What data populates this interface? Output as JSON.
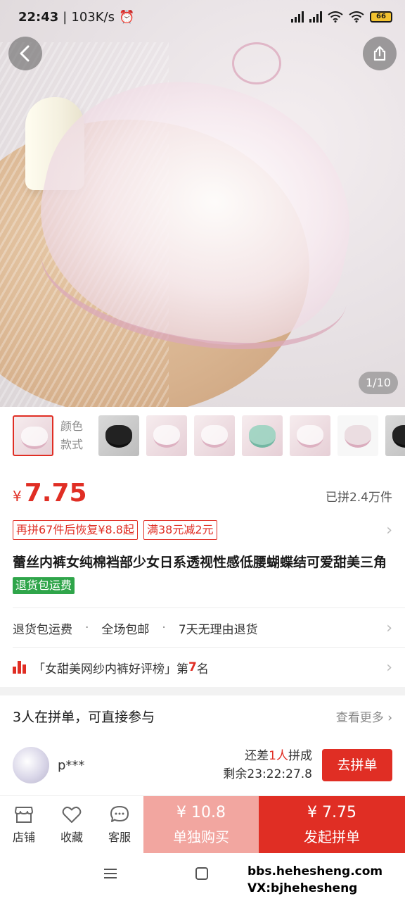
{
  "status_bar": {
    "time": "22:43",
    "speed": "103K/s",
    "battery": "66"
  },
  "gallery": {
    "page_indicator": "1/10"
  },
  "options": {
    "color_label_line1": "颜色",
    "color_label_line2": "款式"
  },
  "price": {
    "currency": "¥",
    "value": "7.75",
    "sold": "已拼2.4万件"
  },
  "promos": {
    "restore_tag": "再拼67件后恢复¥8.8起",
    "discount_tag": "满38元减2元"
  },
  "product": {
    "title": "蕾丝内裤女纯棉裆部少女日系透视性感低腰蝴蝶结可爱甜美三角",
    "badge": "退货包运费"
  },
  "services": {
    "item1": "退货包运费",
    "item2": "全场包邮",
    "item3": "7天无理由退货",
    "separator": "·"
  },
  "ranking": {
    "prefix": "「女甜美网纱内裤好评榜」第",
    "rank": "7",
    "suffix": "名"
  },
  "group_buy": {
    "heading": "3人在拼单，可直接参与",
    "more": "查看更多",
    "user": {
      "name": "p***",
      "need_prefix": "还差",
      "need_count": "1人",
      "need_suffix": "拼成",
      "remaining": "剩余23:22:27.8",
      "join_label": "去拼单"
    }
  },
  "bottom_bar": {
    "store": "店铺",
    "favorite": "收藏",
    "service": "客服",
    "single_price": "¥ 10.8",
    "single_label": "单独购买",
    "group_price": "¥ 7.75",
    "group_label": "发起拼单"
  },
  "watermark": {
    "line1": "bbs.hehesheng.com",
    "line2": "VX:bjhehesheng"
  },
  "colors": {
    "accent": "#e02e24",
    "single_btn": "#f2a6a0",
    "badge_green": "#2fa54a"
  }
}
